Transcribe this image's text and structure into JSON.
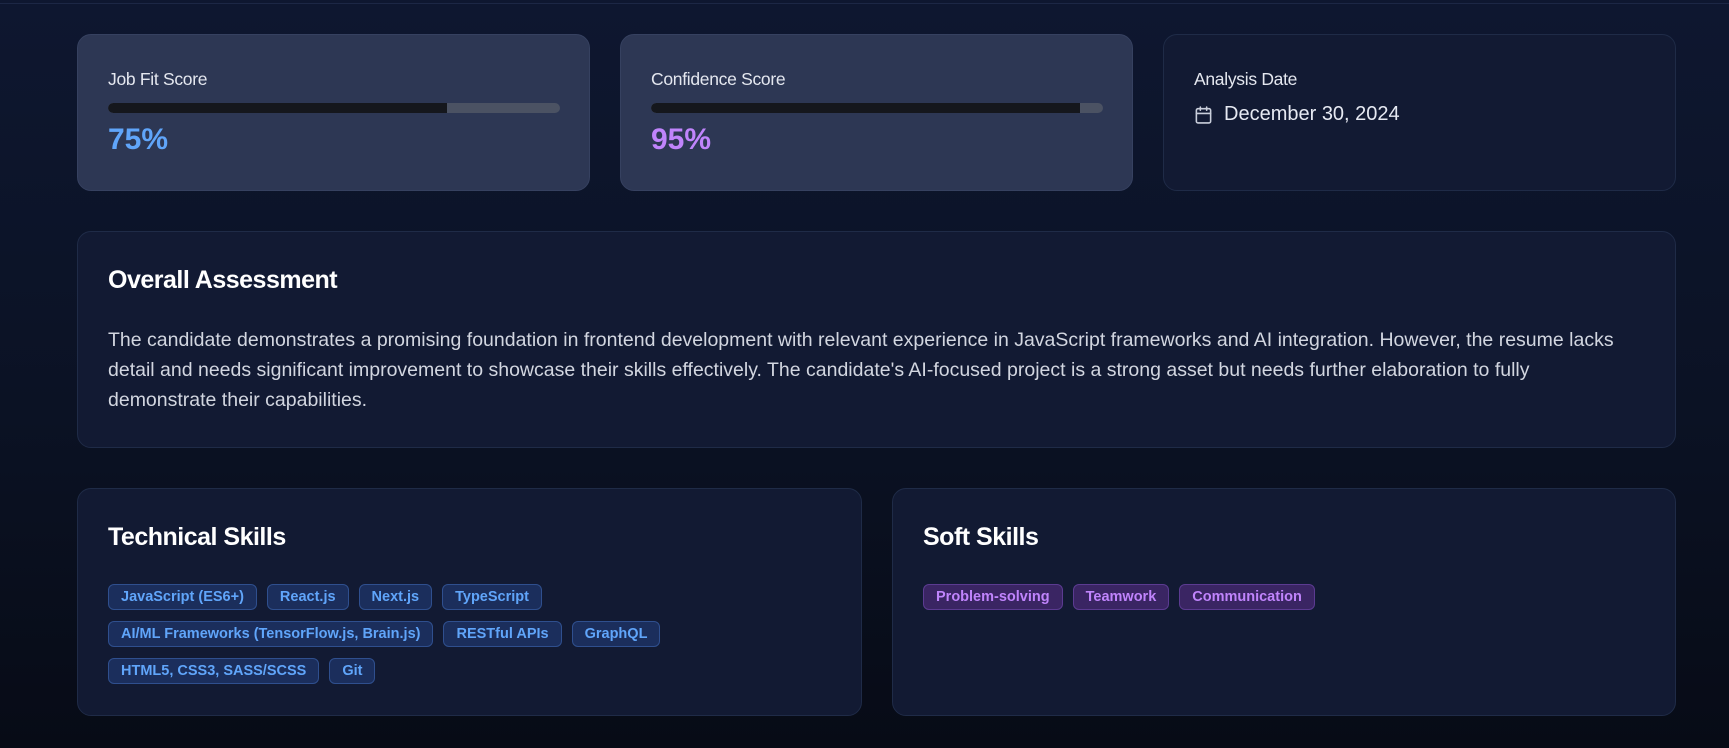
{
  "metrics": {
    "job_fit": {
      "label": "Job Fit Score",
      "value": "75%",
      "progress": 0.75
    },
    "confidence": {
      "label": "Confidence Score",
      "value": "95%",
      "progress": 0.95
    },
    "analysis_date": {
      "label": "Analysis Date",
      "value": "December 30, 2024",
      "icon": "calendar-icon"
    }
  },
  "assessment": {
    "title": "Overall Assessment",
    "text": "The candidate demonstrates a promising foundation in frontend development with relevant experience in JavaScript frameworks and AI integration. However, the resume lacks detail and needs significant improvement to showcase their skills effectively. The candidate's AI-focused project is a strong asset but needs further elaboration to fully demonstrate their capabilities."
  },
  "technical_skills": {
    "title": "Technical Skills",
    "items": [
      "JavaScript (ES6+)",
      "React.js",
      "Next.js",
      "TypeScript",
      "AI/ML Frameworks (TensorFlow.js, Brain.js)",
      "RESTful APIs",
      "GraphQL",
      "HTML5, CSS3, SASS/SCSS",
      "Git"
    ]
  },
  "soft_skills": {
    "title": "Soft Skills",
    "items": [
      "Problem-solving",
      "Teamwork",
      "Communication"
    ]
  },
  "colors": {
    "accent_blue": "#60a5fa",
    "accent_purple": "#c084fc",
    "background": "#0b1224",
    "card": "#121a33",
    "metric_card": "#2d3754"
  }
}
